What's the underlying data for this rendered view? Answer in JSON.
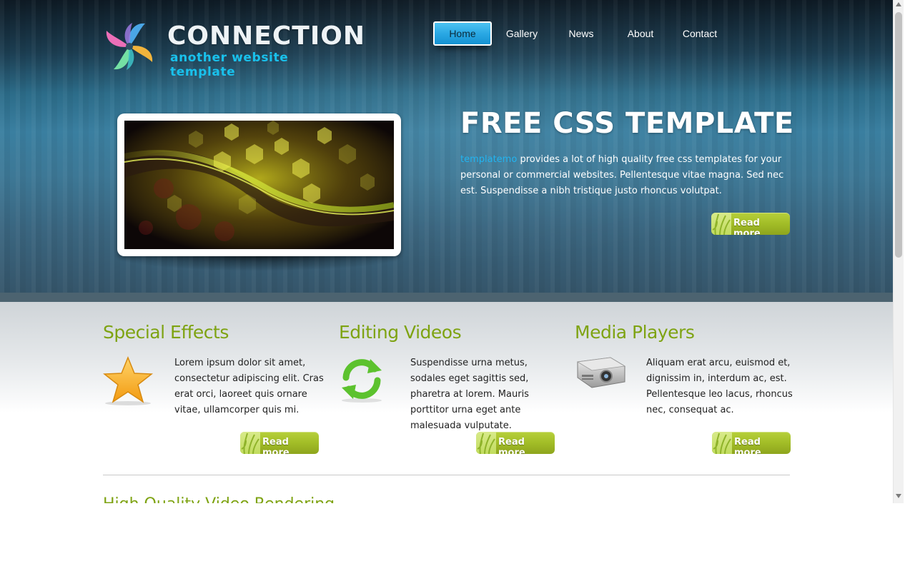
{
  "logo": {
    "title": "CONNECTION",
    "subtitle": "another website template"
  },
  "nav": {
    "items": [
      {
        "label": "Home",
        "active": true
      },
      {
        "label": "Gallery",
        "active": false
      },
      {
        "label": "News",
        "active": false
      },
      {
        "label": "About",
        "active": false
      },
      {
        "label": "Contact",
        "active": false
      }
    ]
  },
  "hero": {
    "title": "FREE CSS TEMPLATE",
    "link_text": "templatemo",
    "text": " provides a lot of high quality free css templates for your personal or commercial websites. Pellentesque vitae magna. Sed nec est. Suspendisse a nibh tristique justo rhoncus volutpat.",
    "read_more": "Read more"
  },
  "features": [
    {
      "title": "Special Effects",
      "icon": "star-icon",
      "text": "Lorem ipsum dolor sit amet, consectetur adipiscing elit. Cras erat orci, laoreet quis ornare vitae, ullamcorper quis mi.",
      "read_more": "Read more"
    },
    {
      "title": "Editing Videos",
      "icon": "refresh-icon",
      "text": "Suspendisse urna metus, sodales eget sagittis sed, pharetra at lorem. Mauris porttitor urna eget ante malesuada vulputate.",
      "read_more": "Read more"
    },
    {
      "title": "Media Players",
      "icon": "projector-icon",
      "text": "Aliquam erat arcu, euismod et, dignissim in, interdum ac, est. Pellentesque leo lacus, rhoncus nec, consequat ac.",
      "read_more": "Read more"
    }
  ],
  "next_section": {
    "title": "High Quality Video Rendering"
  },
  "colors": {
    "accent_green": "#7ea312",
    "link_blue": "#22b4f0",
    "nav_active": "#2aa8e4"
  }
}
